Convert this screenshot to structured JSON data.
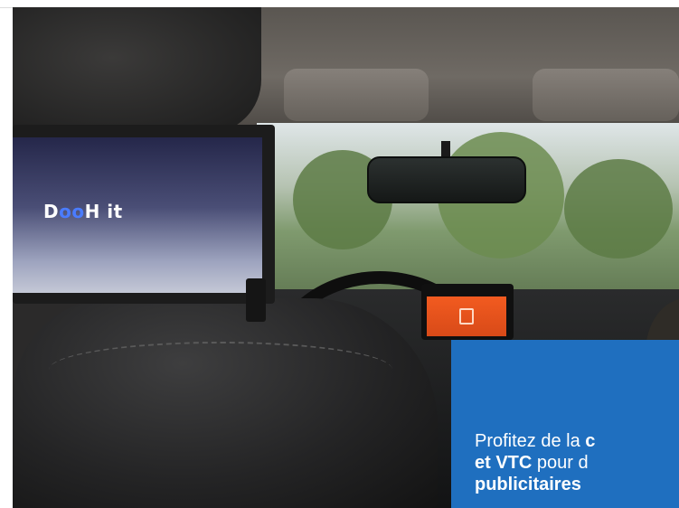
{
  "brand": {
    "text": "DooH it",
    "part1": "D",
    "part2": "oo",
    "part3": "H it"
  },
  "dash_screen": {
    "icon": "taxi-app-icon"
  },
  "caption": {
    "line1_plain": "Profitez de la ",
    "line1_bold": "c",
    "line2_bold_a": "et  VTC",
    "line2_plain": " pour d",
    "line3_bold": "publicitaires",
    "background": "#1f6fbf"
  }
}
